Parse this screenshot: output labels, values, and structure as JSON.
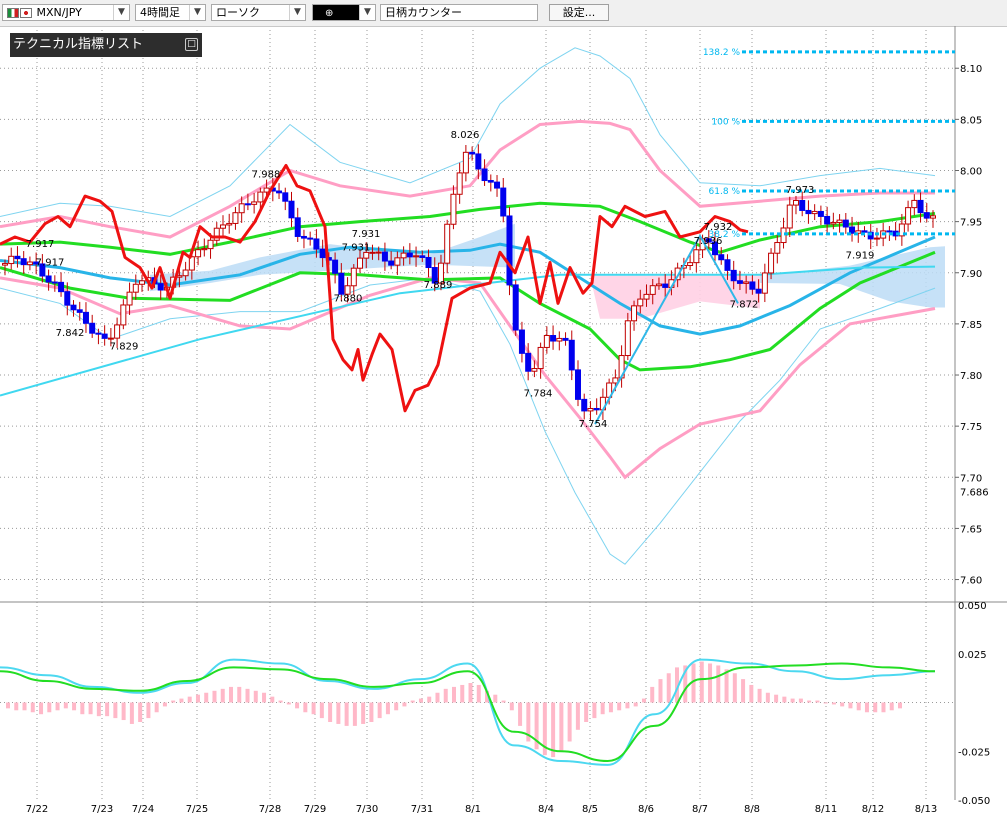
{
  "toolbar": {
    "symbol": "MXN/JPY",
    "timeframe": "4時間足",
    "chart_style": "ローソク",
    "tool_value": "",
    "counter": "日柄カウンター",
    "settings": "設定..."
  },
  "indicator_list_label": "テクニカル指標リスト",
  "colors": {
    "up_candle": "#ffffff",
    "down_candle": "#0000ee",
    "bollinger_inner": "#ff9ec4",
    "bollinger_outer": "#7fd4f0",
    "ma_short": "#22dd22",
    "ma_long": "#28b4e8",
    "rci": "#ee1111",
    "fib": "#00b8f0",
    "macd_hist": "#ffb8c8",
    "cloud_pos": "#bcdcf6",
    "cloud_neg": "#ffd0e4"
  },
  "chart_data": [
    {
      "type": "candlestick",
      "title": "",
      "ylim": [
        7.58,
        8.11
      ],
      "yticks": [
        "8.10",
        "8.05",
        "8.00",
        "7.95",
        "7.90",
        "7.85",
        "7.80",
        "7.75",
        "7.70",
        "7.65",
        "7.60"
      ],
      "current_price_label": "7.686",
      "x": [
        "7/22",
        "7/23",
        "7/24",
        "7/25",
        "7/28",
        "7/29",
        "7/30",
        "7/31",
        "8/1",
        "8/4",
        "8/5",
        "8/6",
        "8/7",
        "8/8",
        "8/11",
        "8/12",
        "8/13"
      ],
      "ohlc_anchors": [
        {
          "label": "7.917",
          "value": 7.917
        },
        {
          "label": "7.917",
          "value": 7.917
        },
        {
          "label": "7.842",
          "value": 7.842
        },
        {
          "label": "7.829",
          "value": 7.829
        },
        {
          "label": "7.988",
          "value": 7.988
        },
        {
          "label": "7.931",
          "value": 7.931
        },
        {
          "label": "7.931",
          "value": 7.931
        },
        {
          "label": "7.880",
          "value": 7.88
        },
        {
          "label": "7.889",
          "value": 7.889
        },
        {
          "label": "8.026",
          "value": 8.026
        },
        {
          "label": "7.784",
          "value": 7.784
        },
        {
          "label": "7.754",
          "value": 7.754
        },
        {
          "label": "7.936",
          "value": 7.936
        },
        {
          "label": "7.932",
          "value": 7.932
        },
        {
          "label": "7.872",
          "value": 7.872
        },
        {
          "label": "7.973",
          "value": 7.973
        },
        {
          "label": "7.919",
          "value": 7.919
        }
      ],
      "fibonacci": [
        {
          "label": "138.2 %",
          "value": 8.116
        },
        {
          "label": "100 %",
          "value": 8.048
        },
        {
          "label": "61.8 %",
          "value": 7.98
        },
        {
          "label": "38.2 %",
          "value": 7.938
        }
      ]
    },
    {
      "type": "line",
      "title": "",
      "ylim": [
        -0.05,
        0.05
      ],
      "yticks": [
        "0.050",
        "0.025",
        "-0.025",
        "-0.050"
      ],
      "series": [
        {
          "values": [
            0.018,
            0.014,
            0.008,
            0.005,
            0.01,
            0.022,
            0.02,
            0.011,
            0.007,
            0.012,
            0.02,
            -0.022,
            -0.03,
            -0.032,
            -0.006,
            0.022,
            0.02,
            0.016,
            0.012,
            0.014,
            0.016
          ]
        },
        {
          "values": [
            0.016,
            0.011,
            0.007,
            0.006,
            0.011,
            0.018,
            0.017,
            0.012,
            0.008,
            0.01,
            0.016,
            -0.015,
            -0.025,
            -0.03,
            -0.012,
            0.012,
            0.018,
            0.019,
            0.02,
            0.018,
            0.016
          ]
        }
      ]
    }
  ]
}
